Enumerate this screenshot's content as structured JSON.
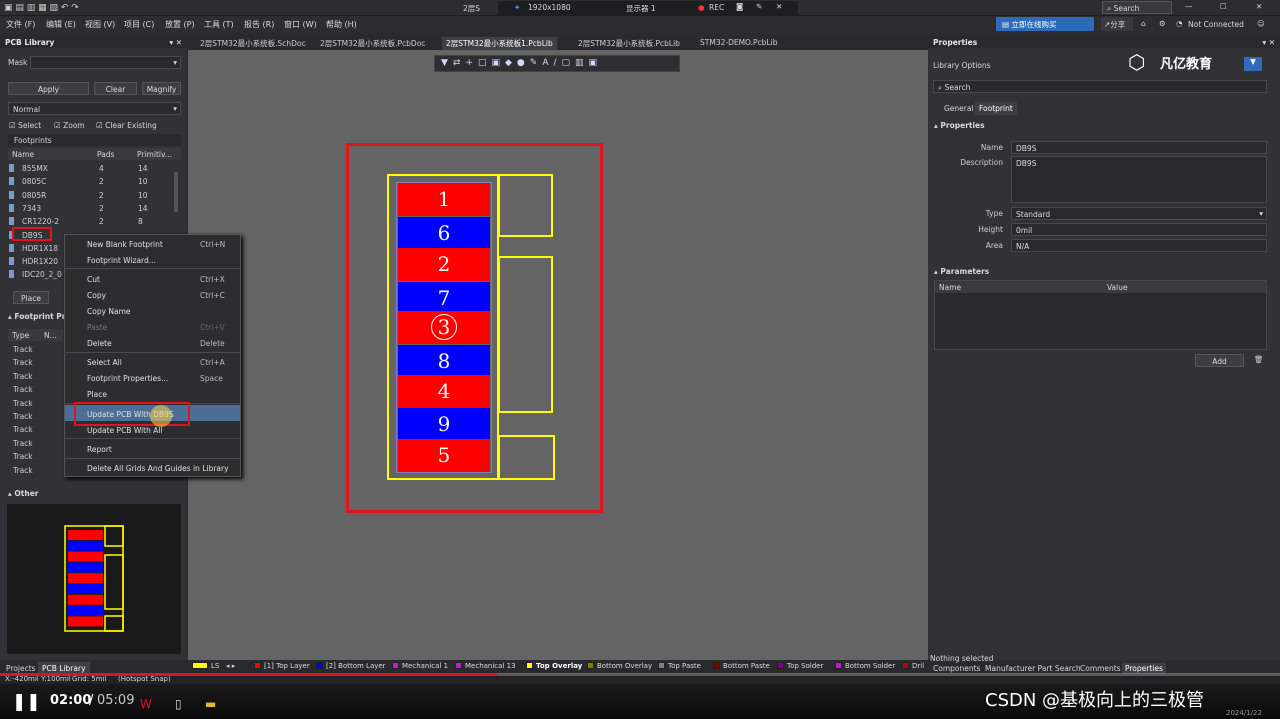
{
  "titlebar": {
    "center": "2层S",
    "resolution": "1920x1080",
    "monitor": "显示器 1",
    "rec": "REC",
    "search_placeholder": "Search"
  },
  "menu": [
    "文件 (F)",
    "编辑 (E)",
    "视图 (V)",
    "项目 (C)",
    "放置 (P)",
    "工具 (T)",
    "报告 (R)",
    "窗口 (W)",
    "帮助 (H)"
  ],
  "top_right": {
    "buy": "立即在线购买",
    "share": "分享",
    "connection": "Not Connected"
  },
  "tabs": [
    "2层STM32最小系统板.SchDoc",
    "2层STM32最小系统板.PcbDoc",
    "2层STM32最小系统板1.PcbLib",
    "2层STM32最小系统板.PcbLib",
    "STM32-DEMO.PcbLib"
  ],
  "left": {
    "title": "PCB Library",
    "mask_label": "Mask",
    "apply": "Apply",
    "clear": "Clear",
    "magnify": "Magnify",
    "mode": "Normal",
    "checks": [
      "Select",
      "Zoom",
      "Clear Existing"
    ],
    "footprints_header": "Footprints",
    "cols": [
      "Name",
      "Pads",
      "Primitiv..."
    ],
    "rows": [
      {
        "name": "855MX",
        "pads": "4",
        "prim": "14"
      },
      {
        "name": "0805C",
        "pads": "2",
        "prim": "10"
      },
      {
        "name": "0805R",
        "pads": "2",
        "prim": "10"
      },
      {
        "name": "7343",
        "pads": "2",
        "prim": "14"
      },
      {
        "name": "CR1220-2",
        "pads": "2",
        "prim": "8"
      },
      {
        "name": "DB9S",
        "pads": "",
        "prim": ""
      },
      {
        "name": "HDR1X18",
        "pads": "",
        "prim": ""
      },
      {
        "name": "HDR1X20",
        "pads": "",
        "prim": ""
      },
      {
        "name": "IDC20_2_0",
        "pads": "",
        "prim": ""
      }
    ],
    "place": "Place",
    "prims_header": "Footprint Prim",
    "prim_cols": [
      "Type",
      "N..."
    ],
    "prim_rows": [
      "Track",
      "Track",
      "Track",
      "Track",
      "Track",
      "Track",
      "Track",
      "Track",
      "Track",
      "Track"
    ],
    "other_header": "Other",
    "bottom_tabs": [
      "Projects",
      "PCB Library"
    ]
  },
  "context_menu": [
    {
      "label": "New Blank Footprint",
      "key": "Ctrl+N"
    },
    {
      "label": "Footprint Wizard...",
      "key": ""
    },
    {
      "label": "Cut",
      "key": "Ctrl+X"
    },
    {
      "label": "Copy",
      "key": "Ctrl+C"
    },
    {
      "label": "Copy Name",
      "key": ""
    },
    {
      "label": "Paste",
      "key": "Ctrl+V"
    },
    {
      "label": "Delete",
      "key": "Delete"
    },
    {
      "label": "Select All",
      "key": "Ctrl+A"
    },
    {
      "label": "Footprint Properties...",
      "key": "Space"
    },
    {
      "label": "Place",
      "key": ""
    },
    {
      "label": "Update PCB With DB9S",
      "key": ""
    },
    {
      "label": "Update PCB With All",
      "key": ""
    },
    {
      "label": "Report",
      "key": ""
    },
    {
      "label": "Delete All Grids And Guides in Library",
      "key": ""
    }
  ],
  "pads": [
    "1",
    "6",
    "2",
    "7",
    "3",
    "8",
    "4",
    "9",
    "5"
  ],
  "colors": {
    "top_layer": "#ff0000",
    "bottom_layer": "#0000ff",
    "overlay": "#ffff00",
    "highlight": "#e0141e",
    "canvas": "#646464"
  },
  "layers": [
    {
      "label": "LS",
      "color": "#ffff00"
    },
    {
      "label": "[1] Top Layer",
      "color": "#ff0000"
    },
    {
      "label": "[2] Bottom Layer",
      "color": "#0000ff"
    },
    {
      "label": "Mechanical 1",
      "color": "#c020c0"
    },
    {
      "label": "Mechanical 13",
      "color": "#c020c0"
    },
    {
      "label": "Top Overlay",
      "color": "#ffff00"
    },
    {
      "label": "Bottom Overlay",
      "color": "#808000"
    },
    {
      "label": "Top Paste",
      "color": "#808080"
    },
    {
      "label": "Bottom Paste",
      "color": "#800000"
    },
    {
      "label": "Top Solder",
      "color": "#800080"
    },
    {
      "label": "Bottom Solder",
      "color": "#c020c0"
    },
    {
      "label": "Dril",
      "color": "#c00000"
    }
  ],
  "status": {
    "coords": "X:-420mil Y:100mil",
    "grid": "Grid: 5mil",
    "snap": "(Hotspot Snap)"
  },
  "right": {
    "title": "Properties",
    "library_options": "Library Options",
    "brand": "凡亿教育",
    "search": "Search",
    "tabs": [
      "General",
      "Footprint"
    ],
    "properties_header": "Properties",
    "name_label": "Name",
    "name": "DB9S",
    "desc_label": "Description",
    "desc": "DB9S",
    "type_label": "Type",
    "type": "Standard",
    "height_label": "Height",
    "height": "0mil",
    "area_label": "Area",
    "area": "N/A",
    "params_header": "Parameters",
    "param_cols": [
      "Name",
      "Value"
    ],
    "add": "Add",
    "nothing": "Nothing selected",
    "bottom_tabs": [
      "Components",
      "Manufacturer Part Search",
      "Comments",
      "Properties"
    ]
  },
  "video": {
    "current": "02:00",
    "total": "05:09",
    "progress": 0.388,
    "watermark": "CSDN @基极向上的三极管",
    "date": "2024/1/22"
  }
}
